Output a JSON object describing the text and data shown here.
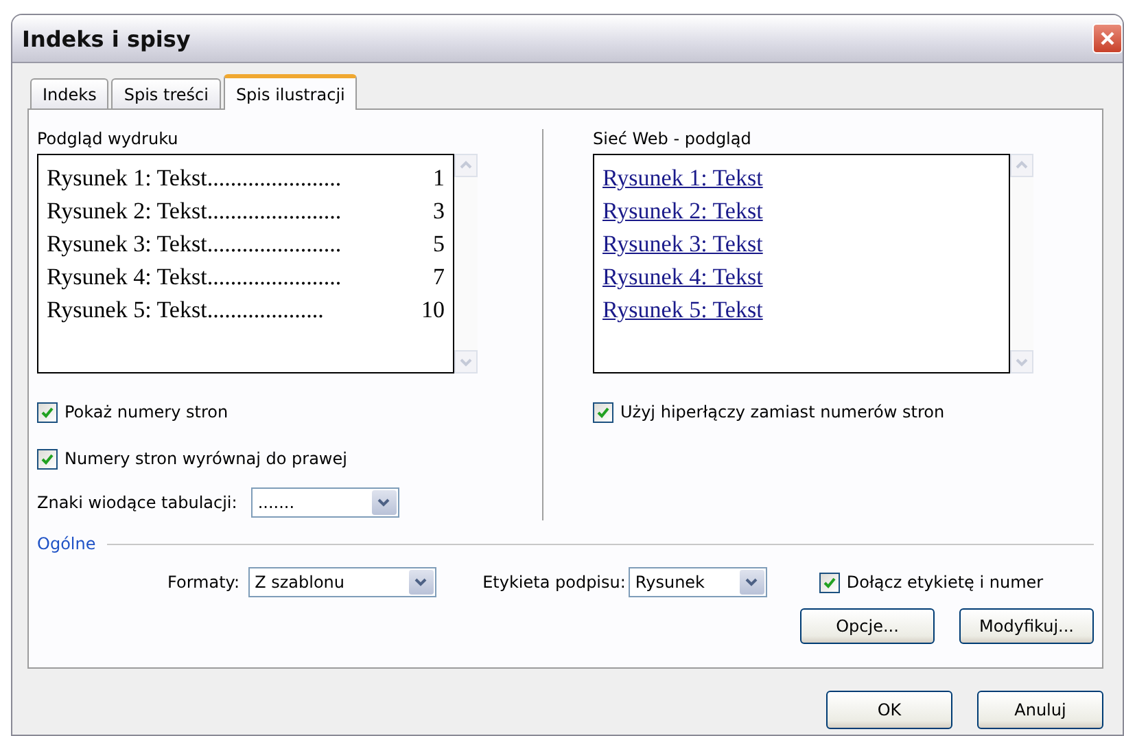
{
  "window": {
    "title": "Indeks i spisy"
  },
  "tabs": [
    {
      "label": "Indeks",
      "selected": false
    },
    {
      "label": "Spis treści",
      "selected": false
    },
    {
      "label": "Spis ilustracji",
      "selected": true
    }
  ],
  "print_preview": {
    "label": "Podgląd wydruku",
    "entries": [
      {
        "text": "Rysunek 1: Tekst",
        "leader": ".......................",
        "page": "1"
      },
      {
        "text": "Rysunek 2: Tekst",
        "leader": ".......................",
        "page": "3"
      },
      {
        "text": "Rysunek 3: Tekst",
        "leader": ".......................",
        "page": "5"
      },
      {
        "text": "Rysunek 4: Tekst",
        "leader": ".......................",
        "page": "7"
      },
      {
        "text": "Rysunek 5: Tekst",
        "leader": "....................",
        "page": "10"
      }
    ]
  },
  "print_options": [
    {
      "label": "Pokaż numery stron",
      "checked": true
    },
    {
      "label": "Numery stron wyrównaj do prawej",
      "checked": true
    }
  ],
  "tab_leader": {
    "label": "Znaki wiodące tabulacji:",
    "value": "......."
  },
  "web_preview": {
    "label": "Sieć Web - podgląd",
    "links": [
      "Rysunek 1: Tekst",
      "Rysunek 2: Tekst",
      "Rysunek 3: Tekst",
      "Rysunek 4: Tekst",
      "Rysunek 5: Tekst"
    ]
  },
  "web_option": {
    "label": "Użyj hiperłączy zamiast numerów stron",
    "checked": true
  },
  "general": {
    "label": "Ogólne",
    "formats": {
      "label": "Formaty:",
      "value": "Z szablonu"
    },
    "caption_label": {
      "label": "Etykieta podpisu:",
      "value": "Rysunek"
    },
    "include_label": {
      "label": "Dołącz etykietę i numer",
      "checked": true
    },
    "buttons": [
      "Opcje...",
      "Modyfikuj..."
    ]
  },
  "footer_buttons": [
    "OK",
    "Anuluj"
  ]
}
